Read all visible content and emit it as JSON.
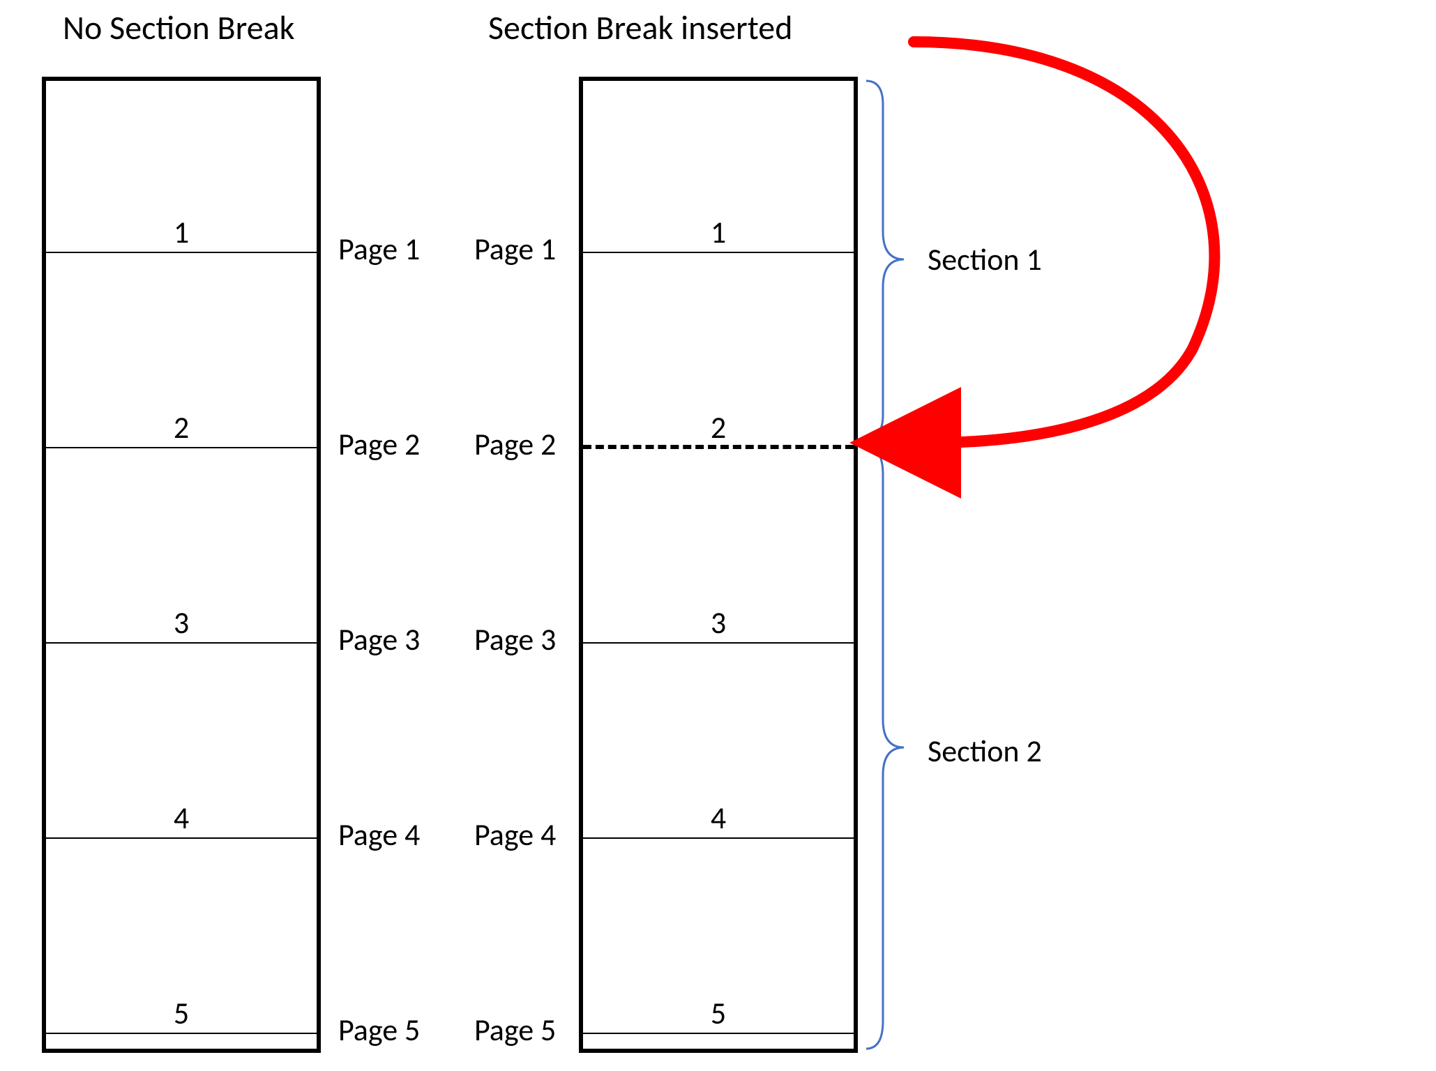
{
  "titles": {
    "left": "No Section Break",
    "right": "Section Break inserted"
  },
  "left": {
    "pages": [
      {
        "num": "1",
        "label": "Page 1"
      },
      {
        "num": "2",
        "label": "Page 2"
      },
      {
        "num": "3",
        "label": "Page 3"
      },
      {
        "num": "4",
        "label": "Page 4"
      },
      {
        "num": "5",
        "label": "Page 5"
      }
    ]
  },
  "right": {
    "pages": [
      {
        "num": "1",
        "label": "Page 1"
      },
      {
        "num": "2",
        "label": "Page 2"
      },
      {
        "num": "3",
        "label": "Page 3"
      },
      {
        "num": "4",
        "label": "Page 4"
      },
      {
        "num": "5",
        "label": "Page 5"
      }
    ]
  },
  "sections": {
    "s1": "Section 1",
    "s2": "Section 2"
  },
  "colors": {
    "brace": "#4472C4",
    "arrow": "#FF0000"
  }
}
